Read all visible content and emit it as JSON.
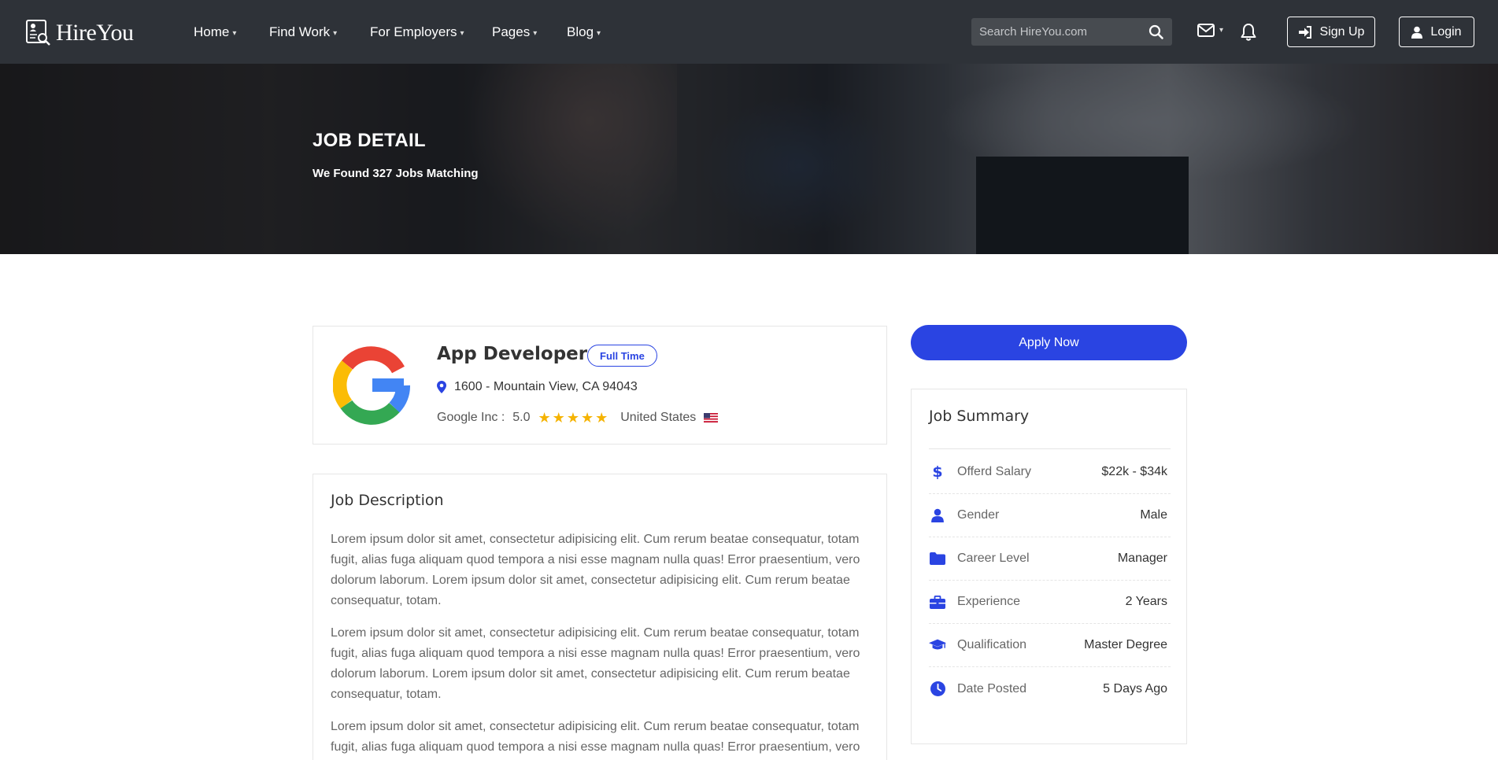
{
  "nav": {
    "brand": "HireYou",
    "items": [
      {
        "label": "Home"
      },
      {
        "label": "Find Work"
      },
      {
        "label": "For Employers"
      },
      {
        "label": "Pages"
      },
      {
        "label": "Blog"
      }
    ],
    "search_placeholder": "Search HireYou.com",
    "signup_label": "Sign Up",
    "login_label": "Login"
  },
  "hero": {
    "title": "JOB DETAIL",
    "subtitle": "We Found 327 Jobs Matching"
  },
  "job": {
    "title": "App Developer",
    "type": "Full Time",
    "location": "1600 - Mountain View, CA 94043",
    "company": "Google Inc :",
    "rating": "5.0",
    "rating_stars": 5,
    "country": "United States"
  },
  "description": {
    "title": "Job Description",
    "paragraphs": [
      "Lorem ipsum dolor sit amet, consectetur adipisicing elit. Cum rerum beatae consequatur, totam fugit, alias fuga aliquam quod tempora a nisi esse magnam nulla quas! Error praesentium, vero dolorum laborum. Lorem ipsum dolor sit amet, consectetur adipisicing elit. Cum rerum beatae consequatur, totam.",
      "Lorem ipsum dolor sit amet, consectetur adipisicing elit. Cum rerum beatae consequatur, totam fugit, alias fuga aliquam quod tempora a nisi esse magnam nulla quas! Error praesentium, vero dolorum laborum. Lorem ipsum dolor sit amet, consectetur adipisicing elit. Cum rerum beatae consequatur, totam.",
      "Lorem ipsum dolor sit amet, consectetur adipisicing elit. Cum rerum beatae consequatur, totam fugit, alias fuga aliquam quod tempora a nisi esse magnam nulla quas! Error praesentium, vero"
    ]
  },
  "sidebar": {
    "apply_label": "Apply Now",
    "summary_title": "Job Summary",
    "rows": [
      {
        "label": "Offerd Salary",
        "value": "$22k - $34k",
        "icon": "dollar-icon"
      },
      {
        "label": "Gender",
        "value": "Male",
        "icon": "user-icon"
      },
      {
        "label": "Career Level",
        "value": "Manager",
        "icon": "folder-icon"
      },
      {
        "label": "Experience",
        "value": "2 Years",
        "icon": "briefcase-icon"
      },
      {
        "label": "Qualification",
        "value": "Master Degree",
        "icon": "graduation-cap-icon"
      },
      {
        "label": "Date Posted",
        "value": "5 Days Ago",
        "icon": "clock-icon"
      }
    ]
  },
  "colors": {
    "accent": "#2a44e2",
    "navbar": "#2e3238",
    "star": "#f5b301"
  }
}
